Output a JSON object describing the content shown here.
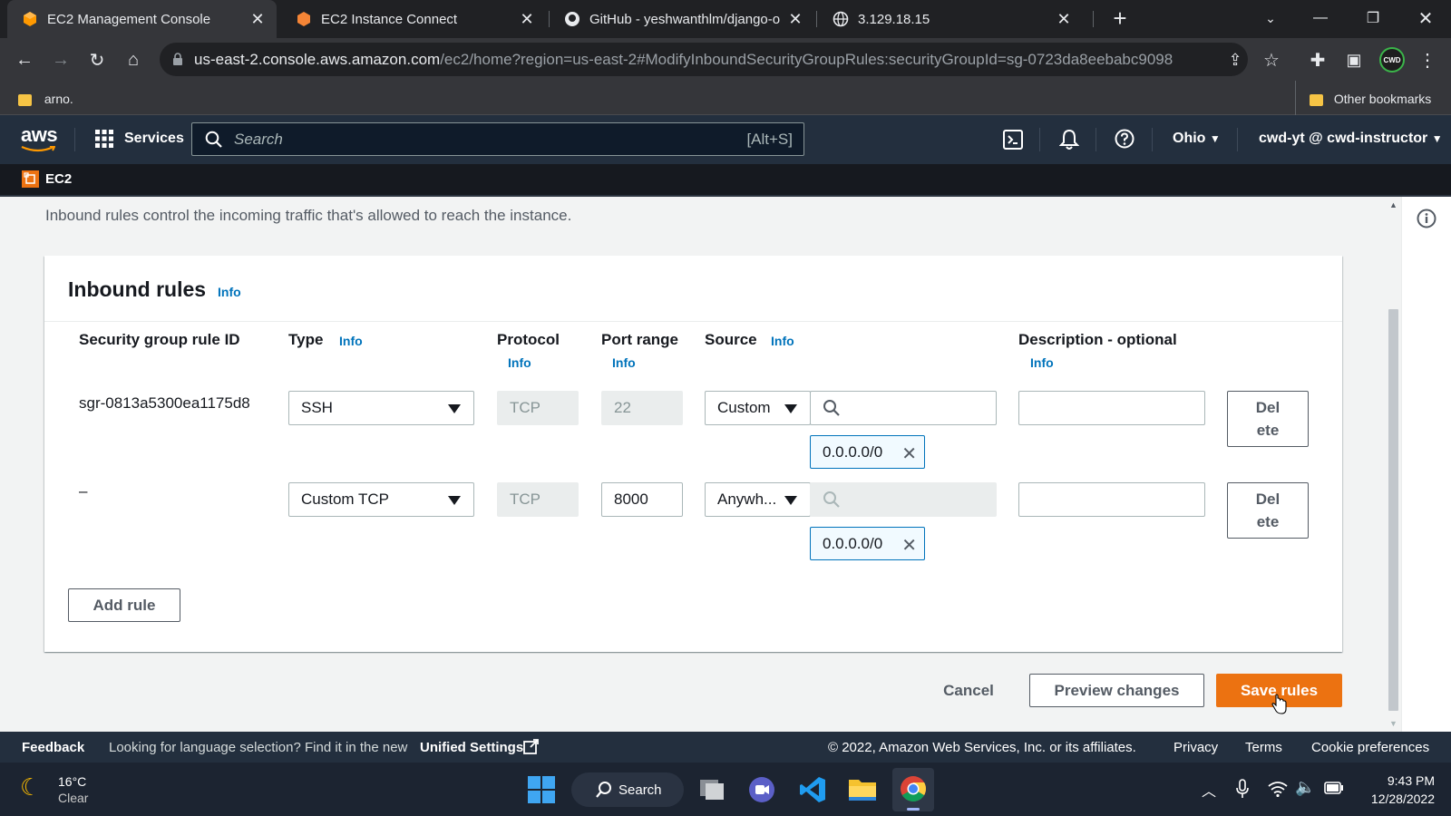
{
  "browser": {
    "tabs": [
      {
        "title": "EC2 Management Console",
        "active": true
      },
      {
        "title": "EC2 Instance Connect",
        "active": false
      },
      {
        "title": "GitHub - yeshwanthlm/django-o",
        "active": false
      },
      {
        "title": "3.129.18.15",
        "active": false
      }
    ],
    "url_host": "us-east-2.console.aws.amazon.com",
    "url_path": "/ec2/home?region=us-east-2#ModifyInboundSecurityGroupRules:securityGroupId=sg-0723da8eebabc9098",
    "bookmarks": {
      "left": "arno.",
      "right": "Other bookmarks"
    },
    "profile_badge": "CWD",
    "icons": [
      "back-icon",
      "forward-icon",
      "reload-icon",
      "home-icon",
      "lock-icon",
      "share-icon",
      "star-icon",
      "extensions-icon",
      "sidepanel-icon",
      "menu-icon"
    ]
  },
  "aws_header": {
    "logo": "aws",
    "services": "Services",
    "search_placeholder": "Search",
    "search_shortcut": "[Alt+S]",
    "region": "Ohio",
    "account": "cwd-yt @ cwd-instructor",
    "service_crumb": "EC2"
  },
  "page": {
    "intro": "Inbound rules control the incoming traffic that's allowed to reach the instance.",
    "panel_title": "Inbound rules",
    "info_label": "Info",
    "columns": {
      "rule_id": "Security group rule ID",
      "type": "Type",
      "protocol": "Protocol",
      "port_range": "Port range",
      "source": "Source",
      "description": "Description - optional"
    },
    "rules": [
      {
        "id": "sgr-0813a5300ea1175d8",
        "type": "SSH",
        "protocol": "TCP",
        "port": "22",
        "source_type": "Custom",
        "cidr": "0.0.0.0/0",
        "description": "",
        "delete_l1": "Del",
        "delete_l2": "ete"
      },
      {
        "id": "–",
        "type": "Custom TCP",
        "protocol": "TCP",
        "port": "8000",
        "source_type": "Anywh...",
        "cidr": "0.0.0.0/0",
        "description": "",
        "delete_l1": "Del",
        "delete_l2": "ete"
      }
    ],
    "add_rule": "Add rule",
    "cancel": "Cancel",
    "preview": "Preview changes",
    "save": "Save rules"
  },
  "footer": {
    "feedback": "Feedback",
    "lang_text": "Looking for language selection? Find it in the new",
    "unified": "Unified Settings",
    "copyright": "© 2022, Amazon Web Services, Inc. or its affiliates.",
    "privacy": "Privacy",
    "terms": "Terms",
    "cookies": "Cookie preferences"
  },
  "taskbar": {
    "temp": "16°C",
    "weather": "Clear",
    "search": "Search",
    "time": "9:43 PM",
    "date": "12/28/2022"
  },
  "colors": {
    "accent": "#ec7211",
    "aws_nav": "#232f3e",
    "link": "#0073bb"
  }
}
